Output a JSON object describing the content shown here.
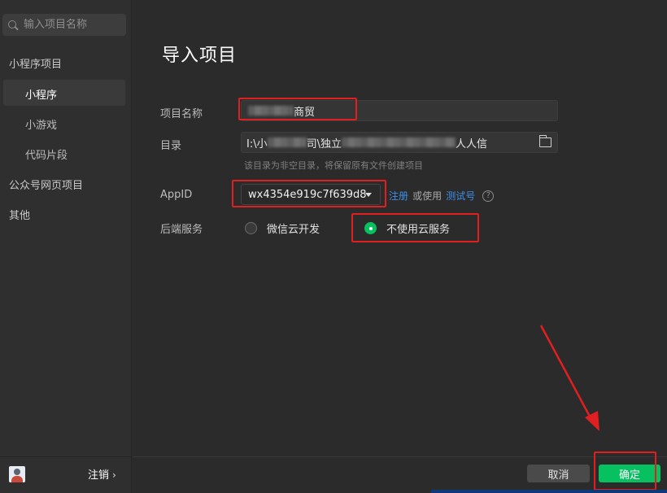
{
  "sidebar": {
    "search_placeholder": "输入项目名称",
    "groups": [
      {
        "label": "小程序项目"
      },
      {
        "label": "公众号网页项目"
      },
      {
        "label": "其他"
      }
    ],
    "items": [
      {
        "label": "小程序",
        "active": true
      },
      {
        "label": "小游戏",
        "active": false
      },
      {
        "label": "代码片段",
        "active": false
      }
    ],
    "logout_label": "注销",
    "logout_chevron": "›",
    "avatar_icon": "user-avatar"
  },
  "main": {
    "title": "导入项目",
    "project_name": {
      "label": "项目名称",
      "value_suffix": "商贸"
    },
    "directory": {
      "label": "目录",
      "value_visible": [
        "I:\\小",
        "司\\独立",
        "人人信"
      ],
      "folder_icon": "folder-icon"
    },
    "hint": "该目录为非空目录，将保留原有文件创建项目",
    "appid": {
      "label": "AppID",
      "value": "wx4354e919c7f639d8",
      "register_link": "注册",
      "or_use_text": "或使用",
      "test_link": "测试号",
      "help_icon": "?"
    },
    "backend": {
      "label": "后端服务",
      "options": [
        {
          "label": "微信云开发",
          "checked": false
        },
        {
          "label": "不使用云服务",
          "checked": true
        }
      ]
    },
    "buttons": {
      "cancel": "取消",
      "confirm": "确定"
    }
  },
  "colors": {
    "accent_green": "#07c160",
    "link_blue": "#3d8fe8",
    "annotation_red": "#e02020",
    "background": "#2b2b2b",
    "sidebar_bg": "#2f2f2f"
  }
}
